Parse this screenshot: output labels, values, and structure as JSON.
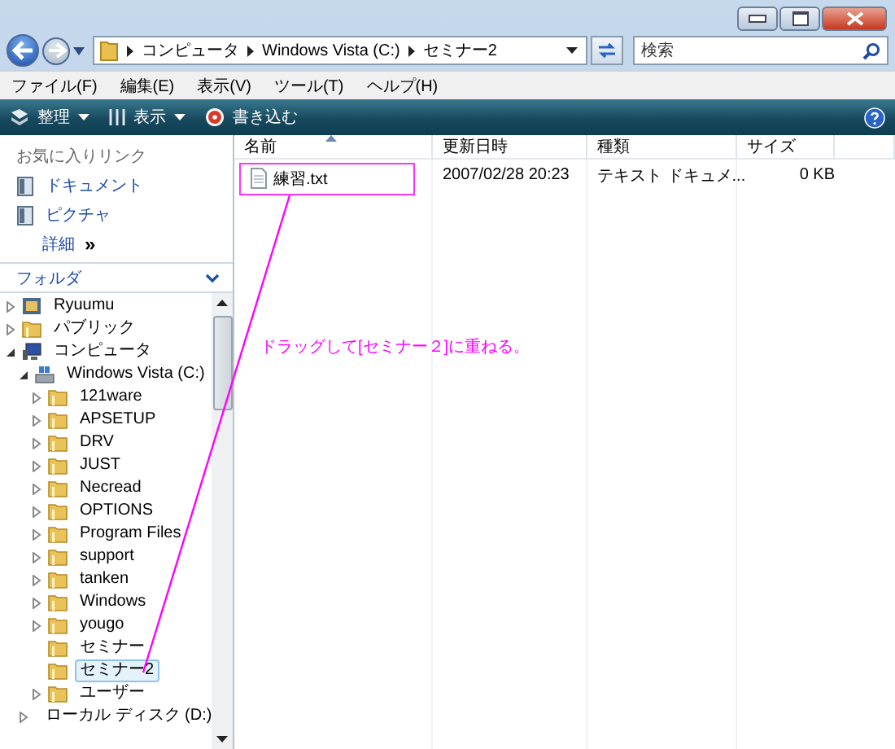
{
  "address_bar": {
    "segments": [
      "コンピュータ",
      "Windows Vista (C:)",
      "セミナー2"
    ]
  },
  "search": {
    "placeholder": "検索"
  },
  "menu": [
    "ファイル(F)",
    "編集(E)",
    "表示(V)",
    "ツール(T)",
    "ヘルプ(H)"
  ],
  "toolbar": [
    {
      "label": "整理",
      "kind": "organize",
      "dropdown": true
    },
    {
      "label": "表示",
      "kind": "views",
      "dropdown": true
    },
    {
      "label": "書き込む",
      "kind": "burn",
      "dropdown": false
    }
  ],
  "favorites": {
    "title": "お気に入りリンク",
    "links": [
      {
        "label": "ドキュメント"
      },
      {
        "label": "ピクチャ"
      }
    ],
    "more": "詳細",
    "more_glyph": "»"
  },
  "folders": {
    "title": "フォルダ",
    "tree": [
      {
        "label": "Ryuumu",
        "kind": "user",
        "expanded": false,
        "has_children": true,
        "selected": false
      },
      {
        "label": "パブリック",
        "kind": "folder",
        "expanded": false,
        "has_children": true,
        "selected": false
      },
      {
        "label": "コンピュータ",
        "kind": "computer",
        "expanded": true,
        "has_children": true,
        "selected": false,
        "children": [
          {
            "label": "Windows Vista (C:)",
            "kind": "drive",
            "expanded": true,
            "has_children": true,
            "selected": false,
            "children": [
              {
                "label": "121ware",
                "kind": "folder",
                "expanded": false,
                "has_children": true,
                "selected": false
              },
              {
                "label": "APSETUP",
                "kind": "folder",
                "expanded": false,
                "has_children": true,
                "selected": false
              },
              {
                "label": "DRV",
                "kind": "folder",
                "expanded": false,
                "has_children": true,
                "selected": false
              },
              {
                "label": "JUST",
                "kind": "folder",
                "expanded": false,
                "has_children": true,
                "selected": false
              },
              {
                "label": "Necread",
                "kind": "folder",
                "expanded": false,
                "has_children": true,
                "selected": false
              },
              {
                "label": "OPTIONS",
                "kind": "folder",
                "expanded": false,
                "has_children": true,
                "selected": false
              },
              {
                "label": "Program Files",
                "kind": "folder",
                "expanded": false,
                "has_children": true,
                "selected": false
              },
              {
                "label": "support",
                "kind": "folder",
                "expanded": false,
                "has_children": true,
                "selected": false
              },
              {
                "label": "tanken",
                "kind": "folder",
                "expanded": false,
                "has_children": true,
                "selected": false
              },
              {
                "label": "Windows",
                "kind": "folder",
                "expanded": false,
                "has_children": true,
                "selected": false
              },
              {
                "label": "yougo",
                "kind": "folder",
                "expanded": false,
                "has_children": true,
                "selected": false
              },
              {
                "label": "セミナー",
                "kind": "folder",
                "expanded": false,
                "has_children": false,
                "selected": false
              },
              {
                "label": "セミナー2",
                "kind": "folder",
                "expanded": false,
                "has_children": false,
                "selected": true
              },
              {
                "label": "ユーザー",
                "kind": "folder",
                "expanded": false,
                "has_children": true,
                "selected": false
              }
            ]
          },
          {
            "label": "ローカル ディスク (D:)",
            "kind": "drive",
            "expanded": false,
            "has_children": true,
            "selected": false
          }
        ]
      }
    ]
  },
  "file_list": {
    "columns": [
      "名前",
      "更新日時",
      "種類",
      "サイズ"
    ],
    "rows": [
      {
        "name": "練習.txt",
        "modified": "2007/02/28 20:23",
        "type": "テキスト ドキュメ...",
        "size": "0 KB",
        "highlighted": true
      }
    ]
  },
  "annotation": {
    "text": "ドラッグして[セミナー２]に重ねる。"
  }
}
